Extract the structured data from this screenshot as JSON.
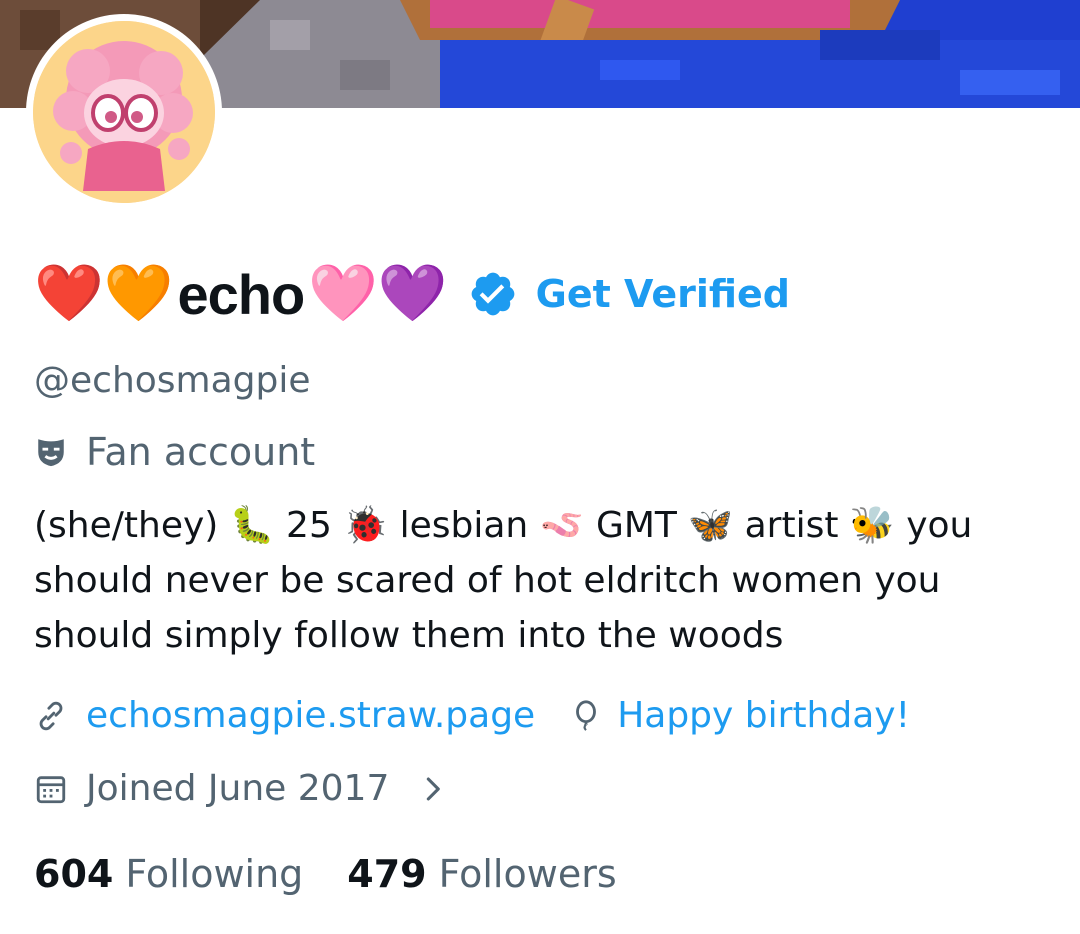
{
  "profile": {
    "display_name": "echo",
    "name_emoji_before": [
      "❤️",
      "🧡"
    ],
    "name_emoji_after": [
      "🩷",
      "💜"
    ],
    "get_verified": "Get Verified",
    "handle": "@echosmagpie",
    "category": "Fan account",
    "category_icon": "mask-icon",
    "bio_parts": [
      {
        "text": "(she/they) "
      },
      {
        "emoji": "🐛"
      },
      {
        "text": " 25 "
      },
      {
        "emoji": "🐞"
      },
      {
        "text": " lesbian "
      },
      {
        "emoji": "🪱"
      },
      {
        "text": " GMT "
      },
      {
        "emoji": "🦋"
      },
      {
        "text": " artist "
      },
      {
        "emoji": "🐝"
      },
      {
        "text": "  you should never be scared of hot eldritch women you should simply follow them into the woods"
      }
    ],
    "website": "echosmagpie.straw.page",
    "birthday": "Happy birthday!",
    "joined": "Joined June 2017",
    "following_count": "604",
    "following_label": "Following",
    "followers_count": "479",
    "followers_label": "Followers"
  },
  "colors": {
    "accent": "#1d9bf0",
    "secondary_text": "#536471",
    "primary_text": "#0f1419"
  }
}
